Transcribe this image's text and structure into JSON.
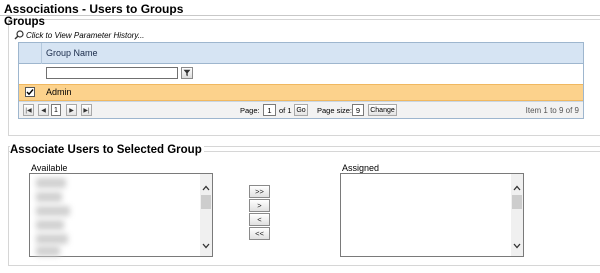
{
  "page": {
    "title": "Associations - Users to Groups"
  },
  "groups": {
    "title": "Groups",
    "history_link": "Click to View Parameter History...",
    "column_header": "Group Name",
    "filter_value": "",
    "rows": [
      {
        "name": "Admin",
        "checked": true
      }
    ],
    "pager": {
      "first": "|◀",
      "prev": "◀",
      "current": "1",
      "next": "▶",
      "last": "▶|",
      "page_label": "Page:",
      "page_value": "1",
      "of_label": "of 1",
      "go_label": "Go",
      "size_label": "Page size:",
      "size_value": "9",
      "change_label": "Change",
      "info": "Item 1 to 9 of 9"
    }
  },
  "associate": {
    "title": "Associate Users to Selected Group",
    "available_label": "Available",
    "assigned_label": "Assigned",
    "buttons": {
      "add_all": ">>",
      "add": ">",
      "remove": "<",
      "remove_all": "<<"
    }
  }
}
